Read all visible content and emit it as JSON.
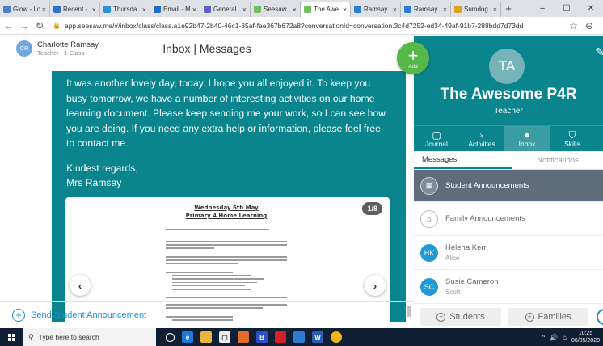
{
  "browser": {
    "tabs": [
      {
        "label": "Glow - Lo",
        "fav": "#4a7ec7"
      },
      {
        "label": "Recent -",
        "fav": "#2f6fd2"
      },
      {
        "label": "Thursda",
        "fav": "#2a8fd8"
      },
      {
        "label": "Email - M",
        "fav": "#1e6fc6"
      },
      {
        "label": "General",
        "fav": "#5b5fc7"
      },
      {
        "label": "Seesaw",
        "fav": "#6fbf5e"
      },
      {
        "label": "The Awe",
        "fav": "#6fbf5e"
      },
      {
        "label": "Ramsay",
        "fav": "#2b7cd3"
      },
      {
        "label": "Ramsay",
        "fav": "#2b7cd3"
      },
      {
        "label": "Sumdog",
        "fav": "#e0a020"
      }
    ],
    "new_tab": "+",
    "window_controls": [
      "–",
      "☐",
      "✕"
    ],
    "url": "app.seesaw.me/#/inbox/class/class.a1e92b47-2b40-46c1-85af-fae367b672a8?conversationId=conversation.3c4d7252-ed34-49af-91b7-288bdd7d73dd"
  },
  "header": {
    "user_initials": "CR",
    "user_name": "Charlotte Ramsay",
    "user_sub": "Teacher - 1 Class",
    "title": "Inbox | Messages"
  },
  "message": {
    "body": "It was another lovely day, today. I hope you all enjoyed it. To keep you busy tomorrow, we have a number of interesting activities on our home learning document. Please keep sending me your work, so I can see how you are doing. If you need any extra help or information, please feel free to contact me.",
    "sign_line1": "Kindest regards,",
    "sign_line2": "Mrs Ramsay"
  },
  "document": {
    "page_counter": "1/8",
    "title_line1": "Wednesday 6th May",
    "title_line2": "Primary 4 Home Learning"
  },
  "footer": {
    "send_label": "Send Student Announcement"
  },
  "add_button": {
    "label": "Add"
  },
  "class_panel": {
    "avatar": "TA",
    "name": "The Awesome P4R",
    "role": "Teacher",
    "nav": [
      {
        "label": "Journal",
        "icon": "▢"
      },
      {
        "label": "Activities",
        "icon": "♀"
      },
      {
        "label": "Inbox",
        "icon": "●"
      },
      {
        "label": "Skills",
        "icon": "⛉"
      }
    ],
    "subtabs": [
      "Messages",
      "Notifications"
    ]
  },
  "conversations": [
    {
      "title": "Student Announcements",
      "sub": "",
      "icon_text": "▦",
      "color": "#7d8d99"
    },
    {
      "title": "Family Announcements",
      "sub": "",
      "icon_text": "⌂",
      "color": "#ffffff"
    },
    {
      "title": "Helena Kerr",
      "sub": "Alice",
      "icon_text": "HK",
      "color": "#1f9ad6"
    },
    {
      "title": "Susie Cameron",
      "sub": "Scott",
      "icon_text": "SC",
      "color": "#1f9ad6"
    }
  ],
  "right_footer": {
    "students_label": "Students",
    "families_label": "Families"
  },
  "taskbar": {
    "search_placeholder": "Type here to search",
    "time": "10:25",
    "date": "06/05/2020"
  }
}
